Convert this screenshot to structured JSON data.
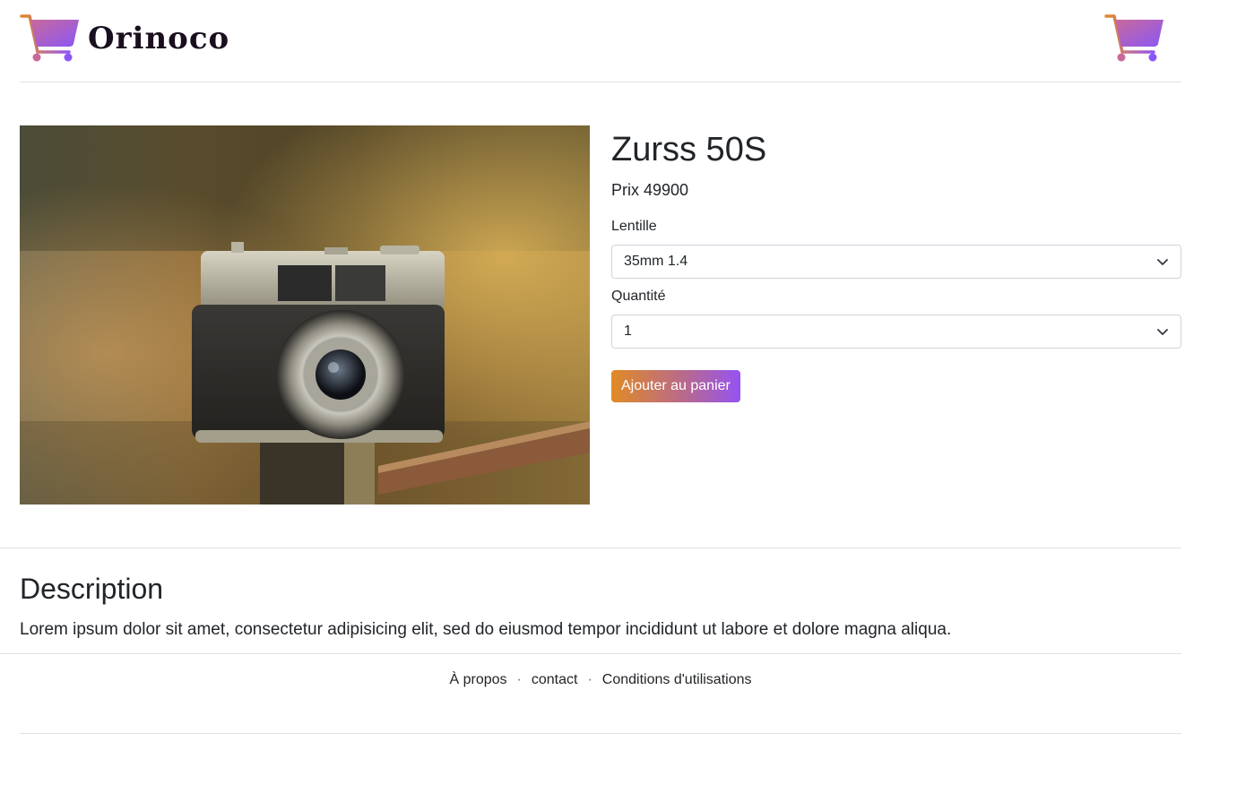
{
  "brand": {
    "name": "Orinoco",
    "logo_icon": "shopping-cart-icon",
    "gradient": [
      "#e08a25",
      "#9553f2"
    ]
  },
  "header": {
    "cart_icon": "shopping-cart-icon"
  },
  "product": {
    "name": "Zurss 50S",
    "price_label": "Prix",
    "price_value": "49900",
    "image_icon": "vintage-camera-photo"
  },
  "form": {
    "lens_label": "Lentille",
    "lens_selected": "35mm 1.4",
    "quantity_label": "Quantité",
    "quantity_selected": "1",
    "add_button_label": "Ajouter au panier"
  },
  "description": {
    "title": "Description",
    "text": "Lorem ipsum dolor sit amet, consectetur adipisicing elit, sed do eiusmod tempor incididunt ut labore et dolore magna aliqua."
  },
  "footer": {
    "links": [
      "À propos",
      "contact",
      "Conditions d'utilisations"
    ],
    "separator": "·"
  }
}
